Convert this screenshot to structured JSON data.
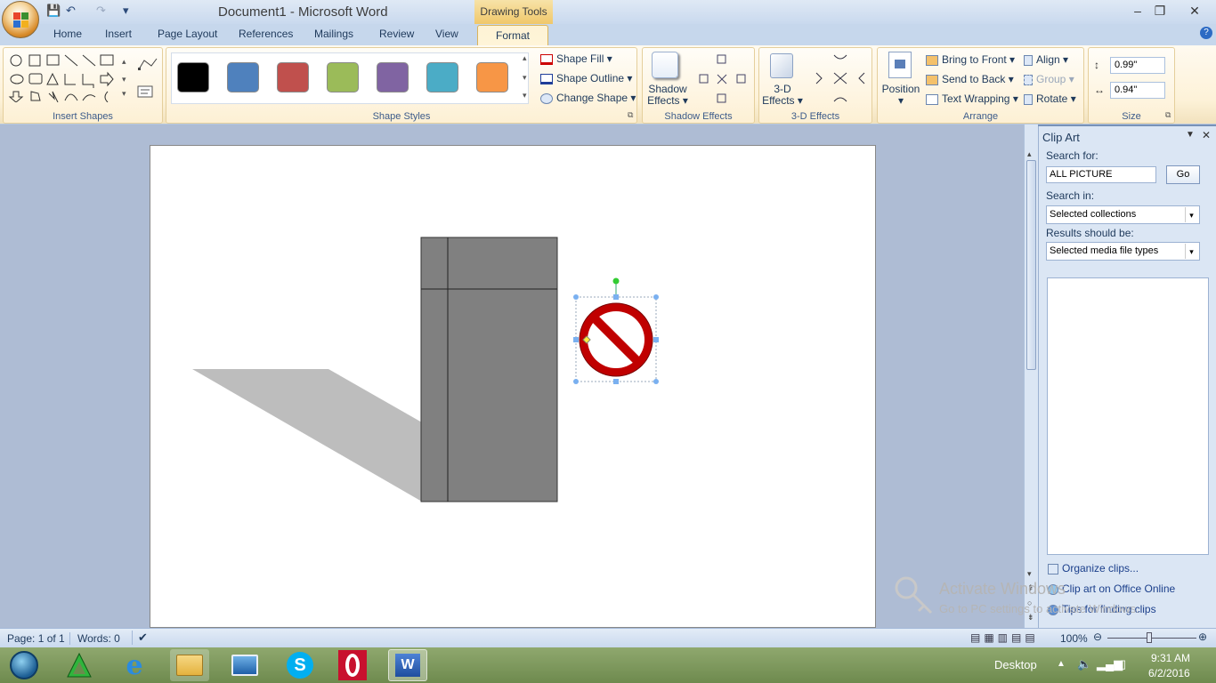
{
  "window": {
    "title": "Document1 - Microsoft Word",
    "context_tab": "Drawing Tools",
    "minimize": "–",
    "maximize": "❐",
    "close": "✕"
  },
  "qat": {
    "save": "💾",
    "undo": "↶",
    "redo": "↷",
    "customize": "▾"
  },
  "tabs": [
    "Home",
    "Insert",
    "Page Layout",
    "References",
    "Mailings",
    "Review",
    "View",
    "Format"
  ],
  "ribbon": {
    "insert_shapes": {
      "label": "Insert Shapes"
    },
    "shape_styles": {
      "label": "Shape Styles",
      "swatches": [
        "#000000",
        "#4f81bd",
        "#c0504d",
        "#9bbb59",
        "#8064a2",
        "#4bacc6",
        "#f79646"
      ],
      "shape_fill": "Shape Fill",
      "shape_outline": "Shape Outline",
      "change_shape": "Change Shape"
    },
    "shadow_effects": {
      "label": "Shadow Effects",
      "button": "Shadow",
      "button2": "Effects"
    },
    "three_d": {
      "label": "3-D Effects",
      "button": "3-D",
      "button2": "Effects"
    },
    "arrange": {
      "label": "Arrange",
      "position": "Position",
      "bring_to_front": "Bring to Front",
      "send_to_back": "Send to Back",
      "text_wrapping": "Text Wrapping",
      "align": "Align",
      "group": "Group",
      "rotate": "Rotate"
    },
    "size": {
      "label": "Size",
      "height": "0.99\"",
      "width": "0.94\""
    }
  },
  "clipart": {
    "title": "Clip Art",
    "search_label": "Search for:",
    "search_value": "ALL PICTURE",
    "go": "Go",
    "search_in_label": "Search in:",
    "search_in_value": "Selected collections",
    "results_label": "Results should be:",
    "results_value": "Selected media file types",
    "links": [
      "Organize clips...",
      "Clip art on Office Online",
      "Tips for finding clips"
    ]
  },
  "watermark": {
    "line1": "Activate Windows",
    "line2": "Go to PC settings to activate Windows."
  },
  "status": {
    "page": "Page: 1 of 1",
    "words": "Words: 0",
    "zoom": "100%"
  },
  "taskbar": {
    "desktop": "Desktop",
    "time": "9:31 AM",
    "date": "6/2/2016"
  }
}
